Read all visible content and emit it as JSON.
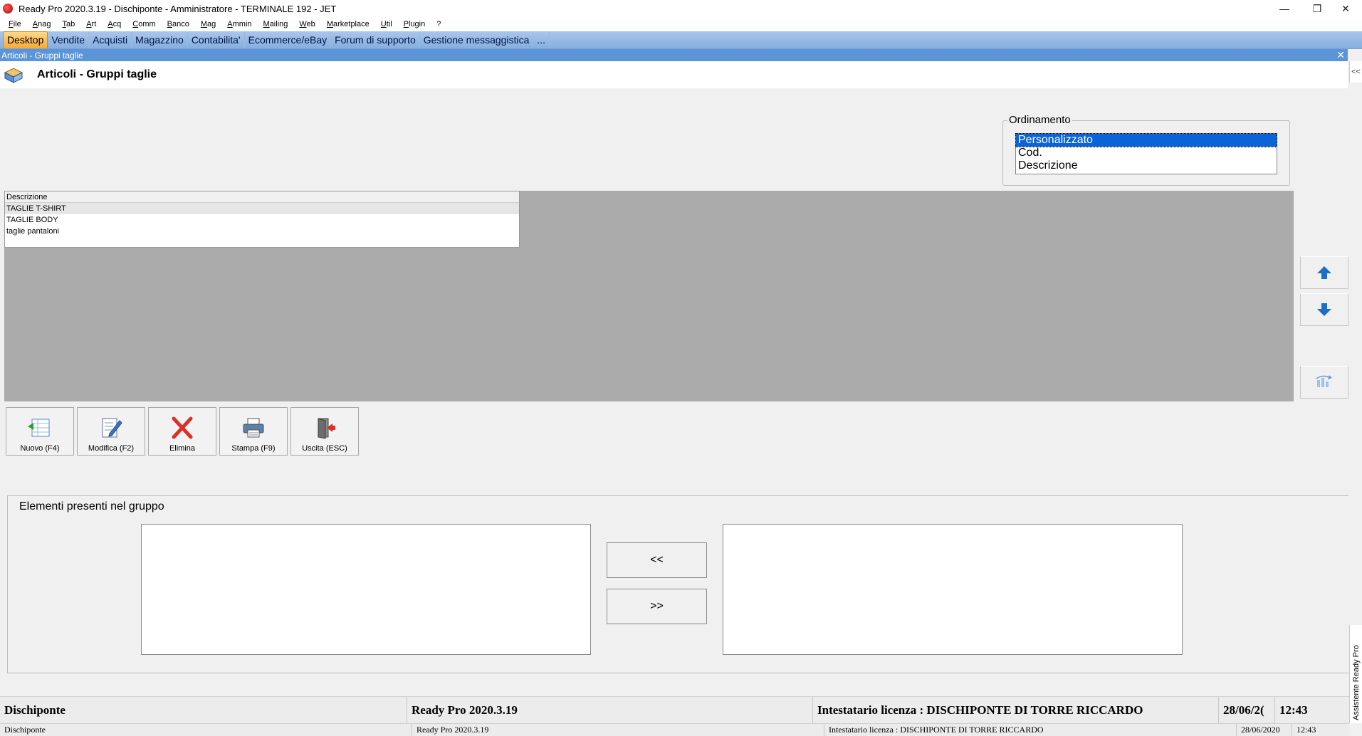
{
  "window": {
    "title": "Ready Pro 2020.3.19 - Dischiponte - Amministratore - TERMINALE 192 - JET",
    "controls": {
      "minimize": "—",
      "restore": "❐",
      "close": "✕"
    }
  },
  "menu": [
    "File",
    "Anag",
    "Tab",
    "Art",
    "Acq",
    "Comm",
    "Banco",
    "Mag",
    "Ammin",
    "Mailing",
    "Web",
    "Marketplace",
    "Util",
    "Plugin",
    "?"
  ],
  "tabs": [
    {
      "label": "Desktop",
      "active": true
    },
    {
      "label": "Vendite"
    },
    {
      "label": "Acquisti"
    },
    {
      "label": "Magazzino"
    },
    {
      "label": "Contabilita'"
    },
    {
      "label": "Ecommerce/eBay"
    },
    {
      "label": "Forum di supporto"
    },
    {
      "label": "Gestione messaggistica"
    },
    {
      "label": "..."
    }
  ],
  "child_window": {
    "caption": "Articoli - Gruppi taglie",
    "close": "✕",
    "header_title": "Articoli - Gruppi taglie",
    "collapse": "<<"
  },
  "ordinamento": {
    "legend": "Ordinamento",
    "options": [
      "Personalizzato",
      "Cod.",
      "Descrizione"
    ],
    "selected": "Personalizzato"
  },
  "grid": {
    "column": "Descrizione",
    "rows": [
      "TAGLIE T-SHIRT",
      "TAGLIE BODY",
      "taglie pantaloni"
    ]
  },
  "toolbar": {
    "new_label": "Nuovo (F4)",
    "edit_label": "Modifica (F2)",
    "delete_label": "Elimina",
    "print_label": "Stampa (F9)",
    "exit_label": "Uscita (ESC)"
  },
  "elementi": {
    "legend": "Elementi presenti nel gruppo",
    "move_left": "<<",
    "move_right": ">>"
  },
  "status": {
    "company": "Dischiponte",
    "version": "Ready Pro 2020.3.19",
    "license": "Intestatario licenza : DISCHIPONTE DI TORRE RICCARDO",
    "date_short": "28/06/2(",
    "time": "12:43",
    "date_full": "28/06/2020"
  },
  "assistant": "Assistente Ready Pro",
  "colors": {
    "accent_blue": "#0a64d8",
    "tab_active": "#f5a935",
    "caption": "#5b95d8",
    "arrow_blue": "#1e6fc4",
    "delete_red": "#d9302a"
  }
}
